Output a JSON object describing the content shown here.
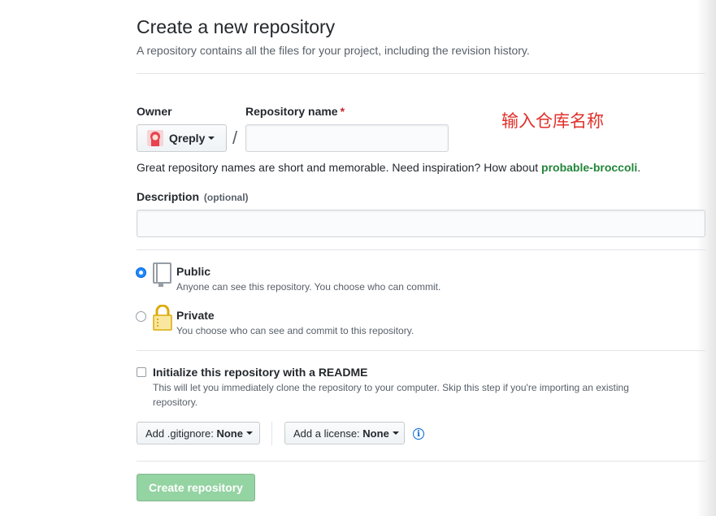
{
  "header": {
    "title": "Create a new repository",
    "subtitle": "A repository contains all the files for your project, including the revision history."
  },
  "owner": {
    "label": "Owner",
    "value": "Qreply"
  },
  "separator": "/",
  "repo_name": {
    "label": "Repository name",
    "required_mark": "*",
    "value": "",
    "placeholder": ""
  },
  "annotation": "输入仓库名称",
  "name_hint": {
    "text": "Great repository names are short and memorable. Need inspiration? How about ",
    "suggestion": "probable-broccoli",
    "end": "."
  },
  "description": {
    "label": "Description",
    "optional": "(optional)",
    "value": "",
    "placeholder": ""
  },
  "visibility": {
    "public": {
      "title": "Public",
      "desc": "Anyone can see this repository. You choose who can commit.",
      "selected": true
    },
    "private": {
      "title": "Private",
      "desc": "You choose who can see and commit to this repository.",
      "selected": false
    }
  },
  "readme": {
    "label": "Initialize this repository with a README",
    "desc_line1": "This will let you immediately clone the repository to your computer. Skip this step if you're importing an existing",
    "desc_line2": "repository.",
    "checked": false
  },
  "gitignore": {
    "label": "Add .gitignore:",
    "value": "None"
  },
  "license": {
    "label": "Add a license:",
    "value": "None"
  },
  "submit": {
    "label": "Create repository"
  },
  "colors": {
    "accent": "#0366d6",
    "suggest_green": "#22863a",
    "submit_disabled": "#94d3a2",
    "annotation_red": "#e0312a"
  }
}
